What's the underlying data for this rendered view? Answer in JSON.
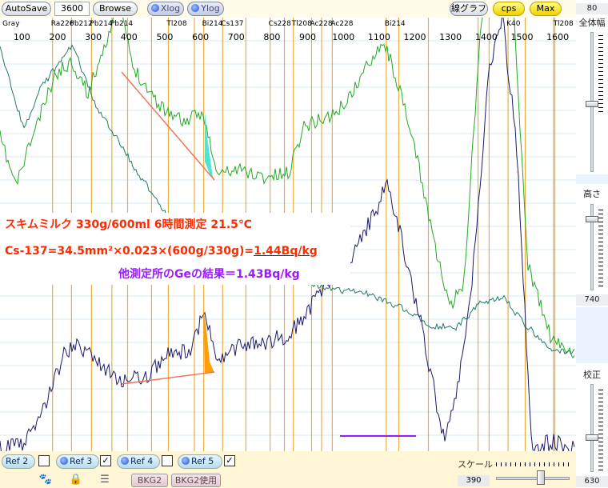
{
  "toolbar": {
    "autosave_label": "AutoSave",
    "time_value": "3600",
    "browse_label": "Browse",
    "xlog_label": "Xlog",
    "ylog_label": "Ylog",
    "line_graph_label": "線グラフ",
    "cps_label": "cps",
    "max_label": "Max"
  },
  "chart_data": {
    "type": "line",
    "x_axis_ticks": [
      "100",
      "200",
      "300",
      "400",
      "500",
      "600",
      "700",
      "800",
      "900",
      "1000",
      "1100",
      "1200",
      "1300",
      "1400",
      "1500",
      "1600"
    ],
    "xlim": [
      50,
      1640
    ],
    "nuclide_labels": [
      {
        "text": "Gray",
        "energy": 50
      },
      {
        "text": "Ra226",
        "energy": 186
      },
      {
        "text": "Pb212",
        "energy": 239
      },
      {
        "text": "Pb214",
        "energy": 295
      },
      {
        "text": "Pb214",
        "energy": 352
      },
      {
        "text": "Tl208",
        "energy": 510
      },
      {
        "text": "Bi214",
        "energy": 609
      },
      {
        "text": "Cs137",
        "energy": 662
      },
      {
        "text": "Cs228",
        "energy": 795
      },
      {
        "text": "Tl208",
        "energy": 860
      },
      {
        "text": "Ac228",
        "energy": 911
      },
      {
        "text": "Ac228",
        "energy": 969
      },
      {
        "text": "Bi214",
        "energy": 1120
      },
      {
        "text": "K40",
        "energy": 1461
      },
      {
        "text": "Tl208",
        "energy": 1592
      }
    ],
    "series": [
      {
        "color": "#22aa22"
      },
      {
        "color": "#1a1a6a"
      },
      {
        "color": "#1f7a6a"
      }
    ]
  },
  "annotation": {
    "line1": "スキムミルク  330g/600ml 6時間測定  21.5℃",
    "line2_prefix": "Cs-137=34.5mm²×0.023×(600g/330g)=",
    "line2_result": "1.44Bq/kg",
    "line3": "他測定所のGeの結果＝1.43Bq/kg"
  },
  "right_panel": {
    "top_value": "80",
    "full_scale_label": "全体幅",
    "height_label": "高さ",
    "height_value": "740",
    "calibration_label": "校正",
    "calibration_value": "630"
  },
  "bottom_panel": {
    "refs": [
      {
        "label": "Ref 2",
        "checked": false
      },
      {
        "label": "Ref 3",
        "checked": true
      },
      {
        "label": "Ref 4",
        "checked": false
      },
      {
        "label": "Ref 5",
        "checked": true
      }
    ],
    "bkg2_label": "BKG2",
    "bkg2_use_label": "BKG2使用",
    "scale_label": "スケール",
    "scale_value": "390"
  },
  "colors": {
    "green_spectrum": "#22aa22",
    "navy_spectrum": "#1a1a6a",
    "teal_spectrum": "#1f7a6a",
    "marker_line": "#e8a020",
    "annotation_red": "#ff2a00",
    "annotation_purple": "#9a1aff"
  }
}
